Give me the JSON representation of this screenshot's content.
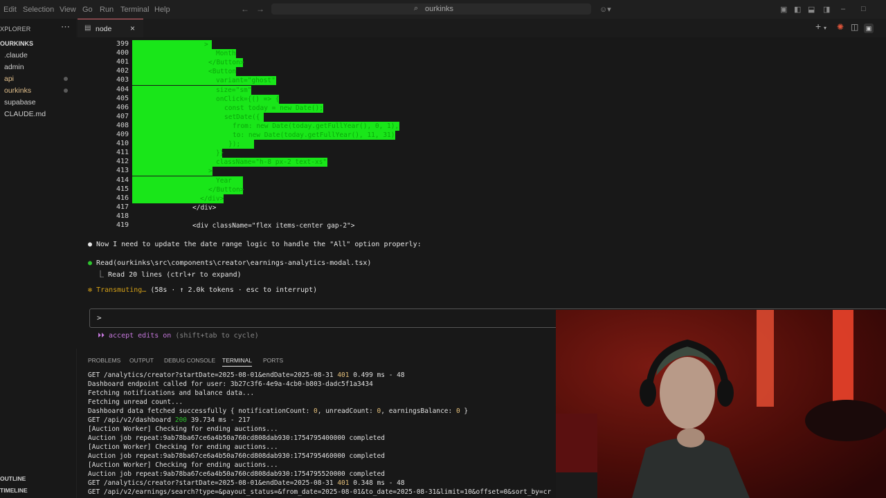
{
  "menu": [
    "Edit",
    "Selection",
    "View",
    "Go",
    "Run",
    "Terminal",
    "Help"
  ],
  "search": {
    "text": "ourkinks",
    "icon": "search-icon"
  },
  "sidebar": {
    "title": "XPLORER",
    "root": "OURKINKS",
    "items": [
      ".claude",
      "admin",
      "api",
      "ourkinks",
      "supabase",
      "CLAUDE.md"
    ],
    "bottom": [
      "OUTLINE",
      "TIMELINE"
    ]
  },
  "tab": {
    "label": "node",
    "close": "×"
  },
  "code": {
    "lines": [
      {
        "n": "399",
        "t": ">",
        "hl": true
      },
      {
        "n": "400",
        "t": "Month",
        "hl": true
      },
      {
        "n": "401",
        "t": "</Button>",
        "hl": true
      },
      {
        "n": "402",
        "t": "<Button",
        "hl": true
      },
      {
        "n": "403",
        "t": "variant=\"ghost\"",
        "hl": true
      },
      {
        "n": "404",
        "t": "size=\"sm\"",
        "hl": true
      },
      {
        "n": "405",
        "t": "onClick={() => {",
        "hl": true
      },
      {
        "n": "406",
        "t": "const today = new Date();",
        "hl": true
      },
      {
        "n": "407",
        "t": "setDate({",
        "hl": true
      },
      {
        "n": "408",
        "t": "from: new Date(today.getFullYear(), 0, 1),",
        "hl": true
      },
      {
        "n": "409",
        "t": "to: new Date(today.getFullYear(), 11, 31)",
        "hl": true
      },
      {
        "n": "410",
        "t": "});",
        "hl": true
      },
      {
        "n": "411",
        "t": "}}",
        "hl": true
      },
      {
        "n": "412",
        "t": "className=\"h-8 px-2 text-xs\"",
        "hl": true
      },
      {
        "n": "413",
        "t": ">",
        "hl": true
      },
      {
        "n": "414",
        "t": "Year",
        "hl": true
      },
      {
        "n": "415",
        "t": "</Button>",
        "hl": true
      },
      {
        "n": "416",
        "t": "</div>",
        "hl": true
      },
      {
        "n": "417",
        "t": "</div>",
        "hl": false
      },
      {
        "n": "418",
        "t": "",
        "hl": false
      },
      {
        "n": "419",
        "t": "<div className=\"flex items-center gap-2\">",
        "hl": false
      }
    ]
  },
  "messages": {
    "m1": "● Now I need to update the date range logic to handle the \"All\" option properly:",
    "m2": "Read(ourkinks\\src\\components\\creator\\earnings-analytics-modal.tsx)",
    "m3": "⎿ Read 20 lines (ctrl+r to expand)",
    "status_star": "✻",
    "status_word": "Transmuting…",
    "status_rest": " (58s · ↑ 2.0k tokens · esc to interrupt)",
    "prompt": ">",
    "accept_a": "⏵⏵ accept edits on",
    "accept_b": " (shift+tab to cycle)"
  },
  "panel": {
    "tabs": [
      "PROBLEMS",
      "OUTPUT",
      "DEBUG CONSOLE",
      "TERMINAL",
      "PORTS"
    ],
    "active": "TERMINAL"
  },
  "terminal": {
    "l1a": "GET /analytics/creator?startDate=2025-08-01&endDate=2025-08-31 ",
    "l1b": "401",
    "l1c": " 0.499 ms - 48",
    "l2": "Dashboard endpoint called for user: 3b27c3f6-4e9a-4cb0-b803-dadc5f1a3434",
    "l3": "Fetching notifications and balance data...",
    "l4": "Fetching unread count...",
    "l5a": "Dashboard data fetched successfully { notificationCount: ",
    "l5b": "0",
    "l5c": ", unreadCount: ",
    "l5d": "0",
    "l5e": ", earningsBalance: ",
    "l5f": "0",
    "l5g": " }",
    "l6a": "GET /api/v2/dashboard ",
    "l6b": "200",
    "l6c": " 39.734 ms - 217",
    "l7": "[Auction Worker] Checking for ending auctions...",
    "l8": "Auction job repeat:9ab78ba67ce6a4b50a760cd808dab930:1754795400000 completed",
    "l9": "[Auction Worker] Checking for ending auctions...",
    "l10": "Auction job repeat:9ab78ba67ce6a4b50a760cd808dab930:1754795460000 completed",
    "l11": "[Auction Worker] Checking for ending auctions...",
    "l12": "Auction job repeat:9ab78ba67ce6a4b50a760cd808dab930:1754795520000 completed",
    "l13a": "GET /analytics/creator?startDate=2025-08-01&endDate=2025-08-31 ",
    "l13b": "401",
    "l13c": " 0.348 ms - 48",
    "l14": "GET /api/v2/earnings/search?type=&payout_status=&from_date=2025-08-01&to_date=2025-08-31&limit=10&offset=0&sort_by=cr"
  }
}
